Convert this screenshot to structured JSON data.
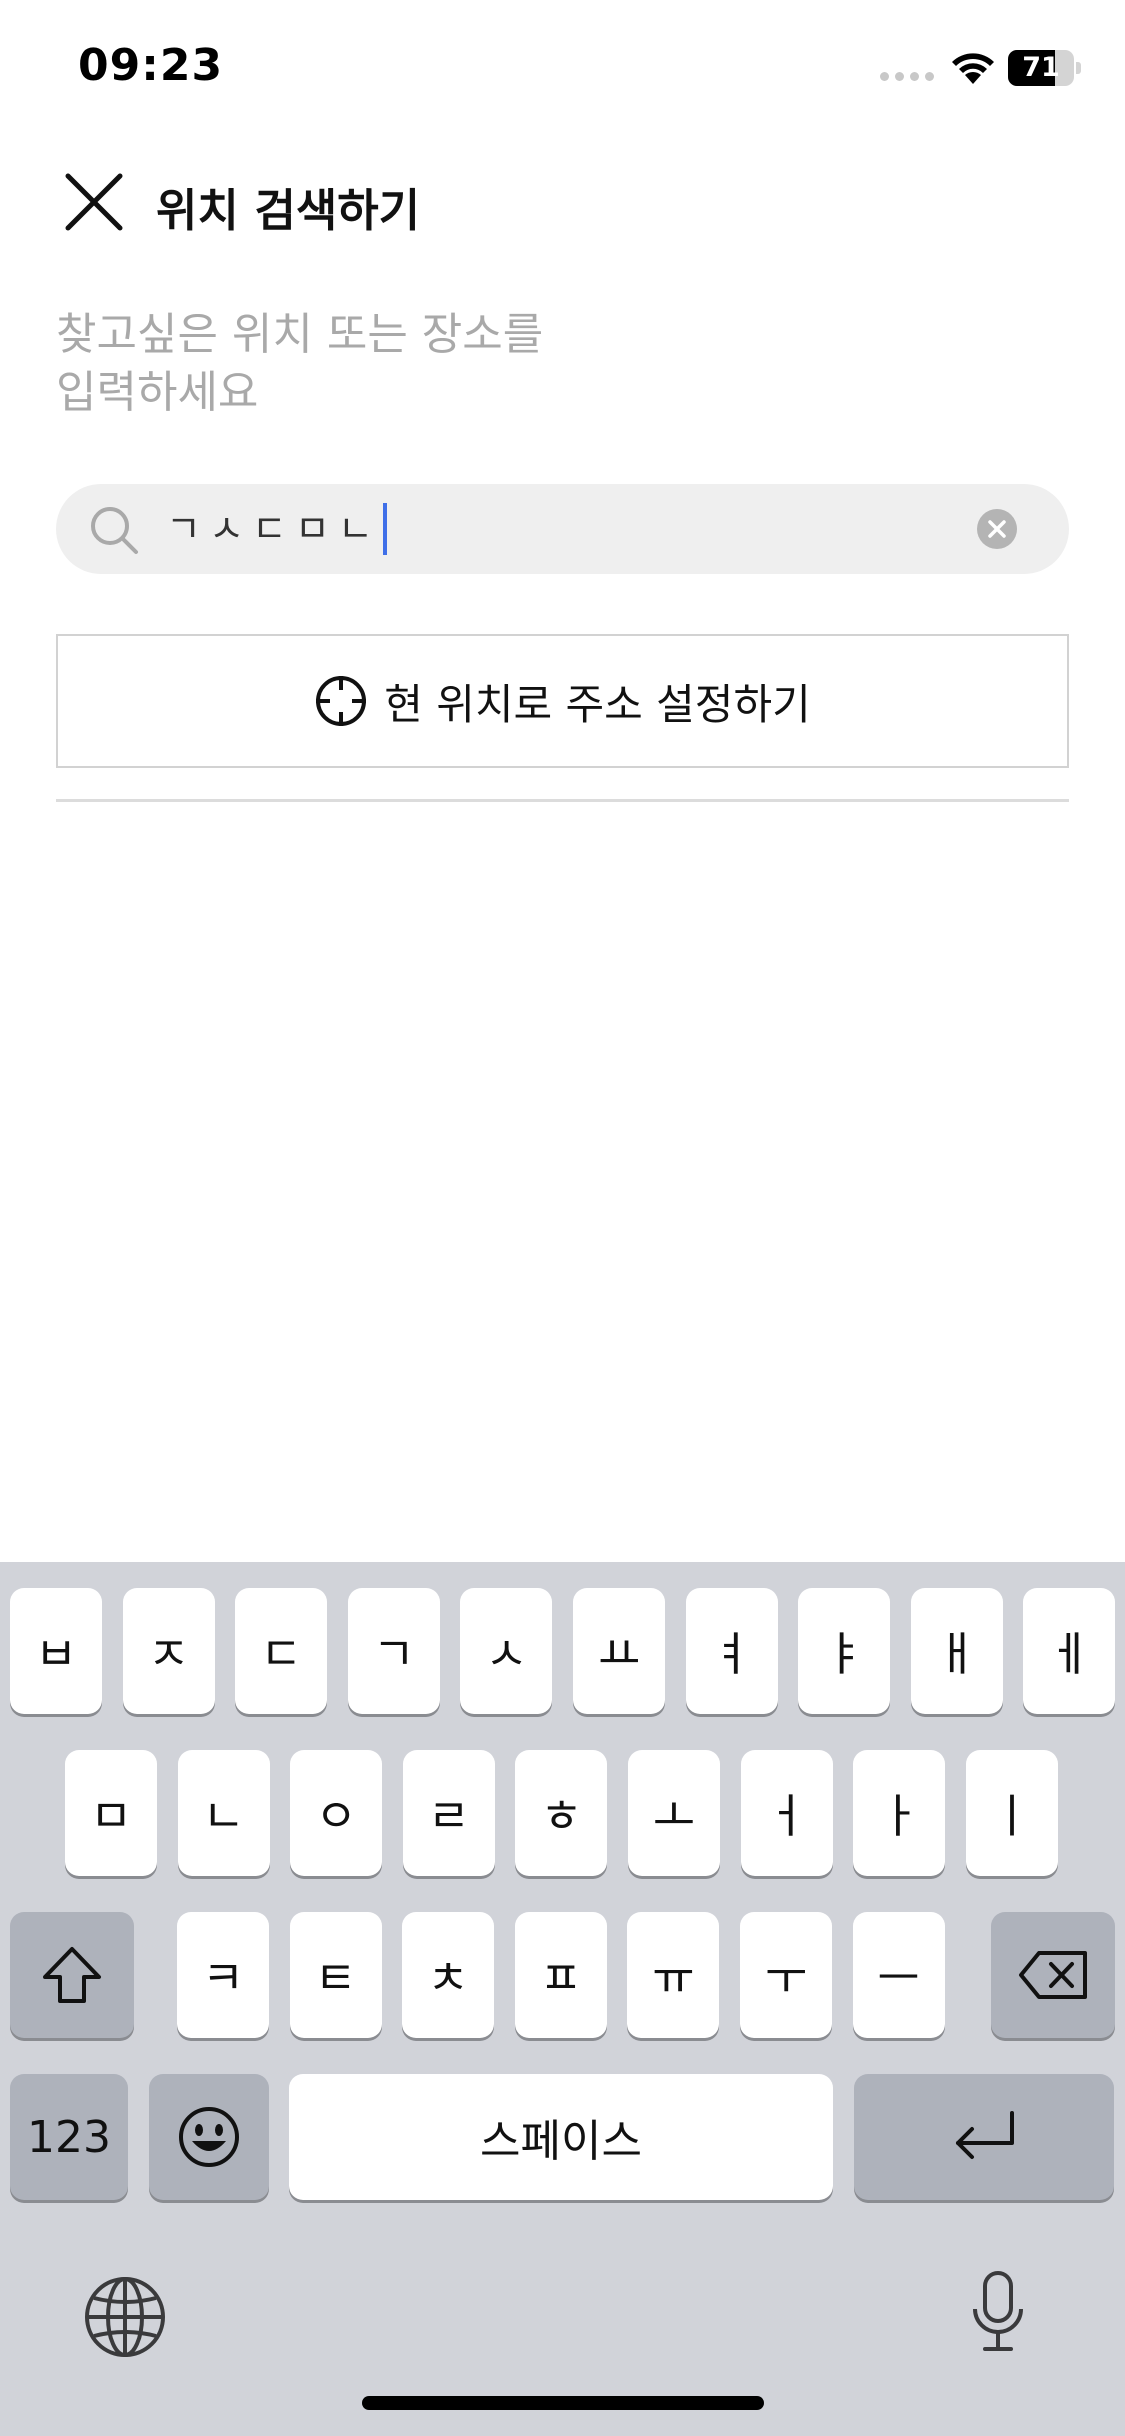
{
  "status_bar": {
    "time": "09:23",
    "battery": "71",
    "battery_level": 0.71
  },
  "header": {
    "title": "위치 검색하기"
  },
  "instruction": {
    "line1": "찾고싶은 위치 또는 장소를",
    "line2": "입력하세요"
  },
  "search": {
    "value": "ㄱㅅㄷㅁㄴ"
  },
  "location_button": {
    "label": "현 위치로 주소 설정하기"
  },
  "keyboard": {
    "row1": [
      "ㅂ",
      "ㅈ",
      "ㄷ",
      "ㄱ",
      "ㅅ",
      "ㅛ",
      "ㅕ",
      "ㅑ",
      "ㅐ",
      "ㅔ"
    ],
    "row2": [
      "ㅁ",
      "ㄴ",
      "ㅇ",
      "ㄹ",
      "ㅎ",
      "ㅗ",
      "ㅓ",
      "ㅏ",
      "ㅣ"
    ],
    "row3": [
      "ㅋ",
      "ㅌ",
      "ㅊ",
      "ㅍ",
      "ㅠ",
      "ㅜ",
      "ㅡ"
    ],
    "numbers_label": "123",
    "space_label": "스페이스"
  },
  "icons": {
    "close": "close-icon",
    "search": "search-icon",
    "clear": "clear-icon",
    "location": "crosshair-icon",
    "shift": "shift-icon",
    "delete": "delete-icon",
    "emoji": "emoji-icon",
    "return": "return-icon",
    "globe": "globe-icon",
    "mic": "microphone-icon"
  },
  "colors": {
    "caret": "#3f6fe8",
    "keyboard_bg": "#d1d3d9",
    "placeholder": "#a9a9a9"
  }
}
